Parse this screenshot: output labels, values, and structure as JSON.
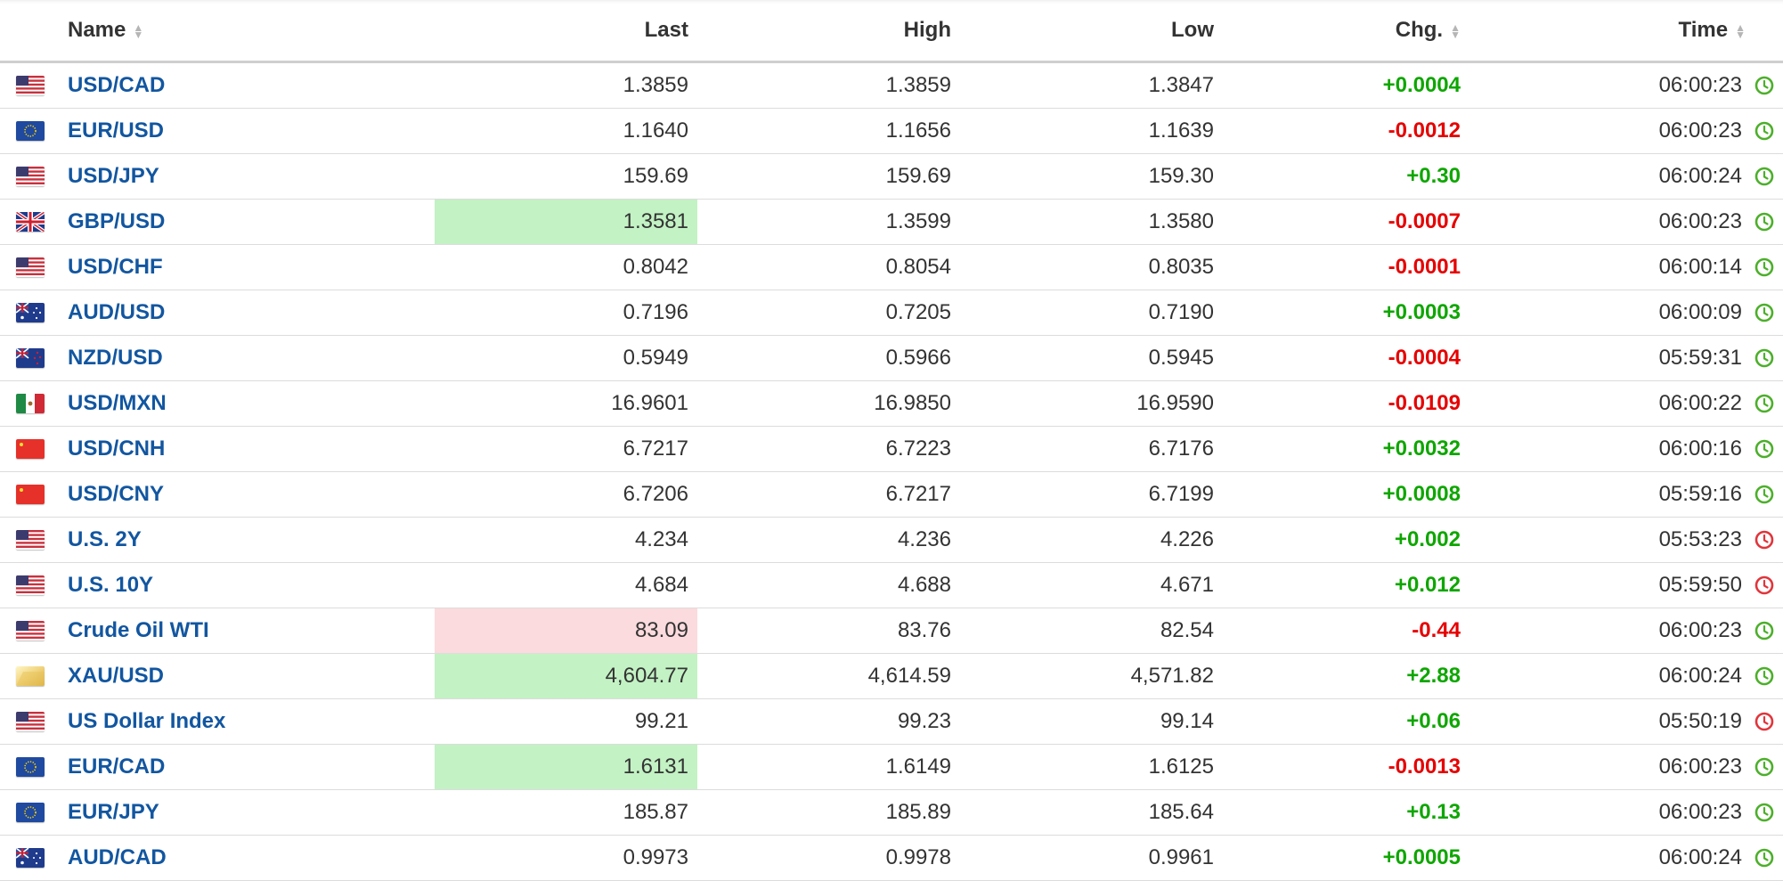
{
  "header": {
    "name": "Name",
    "last": "Last",
    "high": "High",
    "low": "Low",
    "chg": "Chg.",
    "time": "Time"
  },
  "icons": {
    "sort": "sort-icon",
    "clock": "clock-icon"
  },
  "colors": {
    "link": "#1256a0",
    "positive": "#0ea600",
    "negative": "#e60000",
    "flash_green": "#c3f2c4",
    "flash_red": "#fbdbdd",
    "clock_open": "#4caf2a",
    "clock_closed": "#e0353b"
  },
  "rows": [
    {
      "flag": "us",
      "name": "USD/CAD",
      "last": "1.3859",
      "high": "1.3859",
      "low": "1.3847",
      "chg": "+0.0004",
      "dir": "pos",
      "time": "06:00:23",
      "status": "open",
      "flash": ""
    },
    {
      "flag": "eu",
      "name": "EUR/USD",
      "last": "1.1640",
      "high": "1.1656",
      "low": "1.1639",
      "chg": "-0.0012",
      "dir": "neg",
      "time": "06:00:23",
      "status": "open",
      "flash": ""
    },
    {
      "flag": "us",
      "name": "USD/JPY",
      "last": "159.69",
      "high": "159.69",
      "low": "159.30",
      "chg": "+0.30",
      "dir": "pos",
      "time": "06:00:24",
      "status": "open",
      "flash": ""
    },
    {
      "flag": "gb",
      "name": "GBP/USD",
      "last": "1.3581",
      "high": "1.3599",
      "low": "1.3580",
      "chg": "-0.0007",
      "dir": "neg",
      "time": "06:00:23",
      "status": "open",
      "flash": "green"
    },
    {
      "flag": "us",
      "name": "USD/CHF",
      "last": "0.8042",
      "high": "0.8054",
      "low": "0.8035",
      "chg": "-0.0001",
      "dir": "neg",
      "time": "06:00:14",
      "status": "open",
      "flash": ""
    },
    {
      "flag": "au",
      "name": "AUD/USD",
      "last": "0.7196",
      "high": "0.7205",
      "low": "0.7190",
      "chg": "+0.0003",
      "dir": "pos",
      "time": "06:00:09",
      "status": "open",
      "flash": ""
    },
    {
      "flag": "nz",
      "name": "NZD/USD",
      "last": "0.5949",
      "high": "0.5966",
      "low": "0.5945",
      "chg": "-0.0004",
      "dir": "neg",
      "time": "05:59:31",
      "status": "open",
      "flash": ""
    },
    {
      "flag": "mx",
      "name": "USD/MXN",
      "last": "16.9601",
      "high": "16.9850",
      "low": "16.9590",
      "chg": "-0.0109",
      "dir": "neg",
      "time": "06:00:22",
      "status": "open",
      "flash": ""
    },
    {
      "flag": "cn",
      "name": "USD/CNH",
      "last": "6.7217",
      "high": "6.7223",
      "low": "6.7176",
      "chg": "+0.0032",
      "dir": "pos",
      "time": "06:00:16",
      "status": "open",
      "flash": ""
    },
    {
      "flag": "cn",
      "name": "USD/CNY",
      "last": "6.7206",
      "high": "6.7217",
      "low": "6.7199",
      "chg": "+0.0008",
      "dir": "pos",
      "time": "05:59:16",
      "status": "open",
      "flash": ""
    },
    {
      "flag": "us",
      "name": "U.S. 2Y",
      "last": "4.234",
      "high": "4.236",
      "low": "4.226",
      "chg": "+0.002",
      "dir": "pos",
      "time": "05:53:23",
      "status": "closed",
      "flash": ""
    },
    {
      "flag": "us",
      "name": "U.S. 10Y",
      "last": "4.684",
      "high": "4.688",
      "low": "4.671",
      "chg": "+0.012",
      "dir": "pos",
      "time": "05:59:50",
      "status": "closed",
      "flash": ""
    },
    {
      "flag": "us",
      "name": "Crude Oil WTI",
      "last": "83.09",
      "high": "83.76",
      "low": "82.54",
      "chg": "-0.44",
      "dir": "neg",
      "time": "06:00:23",
      "status": "open",
      "flash": "red"
    },
    {
      "flag": "gold",
      "name": "XAU/USD",
      "last": "4,604.77",
      "high": "4,614.59",
      "low": "4,571.82",
      "chg": "+2.88",
      "dir": "pos",
      "time": "06:00:24",
      "status": "open",
      "flash": "green"
    },
    {
      "flag": "us",
      "name": "US Dollar Index",
      "last": "99.21",
      "high": "99.23",
      "low": "99.14",
      "chg": "+0.06",
      "dir": "pos",
      "time": "05:50:19",
      "status": "closed",
      "flash": ""
    },
    {
      "flag": "eu",
      "name": "EUR/CAD",
      "last": "1.6131",
      "high": "1.6149",
      "low": "1.6125",
      "chg": "-0.0013",
      "dir": "neg",
      "time": "06:00:23",
      "status": "open",
      "flash": "green"
    },
    {
      "flag": "eu",
      "name": "EUR/JPY",
      "last": "185.87",
      "high": "185.89",
      "low": "185.64",
      "chg": "+0.13",
      "dir": "pos",
      "time": "06:00:23",
      "status": "open",
      "flash": ""
    },
    {
      "flag": "au",
      "name": "AUD/CAD",
      "last": "0.9973",
      "high": "0.9978",
      "low": "0.9961",
      "chg": "+0.0005",
      "dir": "pos",
      "time": "06:00:24",
      "status": "open",
      "flash": ""
    }
  ]
}
